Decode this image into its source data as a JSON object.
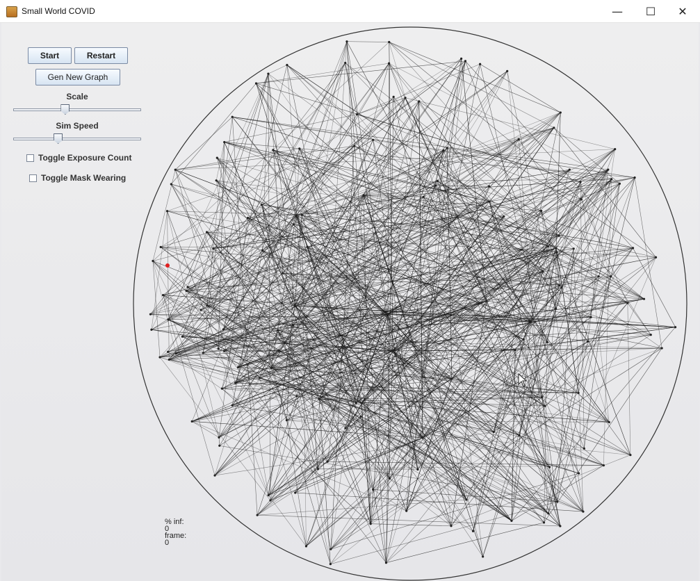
{
  "window": {
    "title": "Small World COVID",
    "controls": {
      "minimize": "—",
      "maximize": "☐",
      "close": "✕"
    }
  },
  "controls": {
    "start_label": "Start",
    "restart_label": "Restart",
    "gen_graph_label": "Gen New Graph",
    "scale_label": "Scale",
    "scale_value": 0.4,
    "sim_speed_label": "Sim Speed",
    "sim_speed_value": 0.34,
    "toggle_exposure_label": "Toggle Exposure Count",
    "toggle_exposure_checked": false,
    "toggle_mask_label": "Toggle Mask Wearing",
    "toggle_mask_checked": false
  },
  "stats": {
    "infected_label": "% inf:",
    "infected_value": "0",
    "frame_label": "frame:",
    "frame_value": "0"
  },
  "colors": {
    "edge": "#111111",
    "node": "#222222",
    "infected_node": "#e02020"
  }
}
